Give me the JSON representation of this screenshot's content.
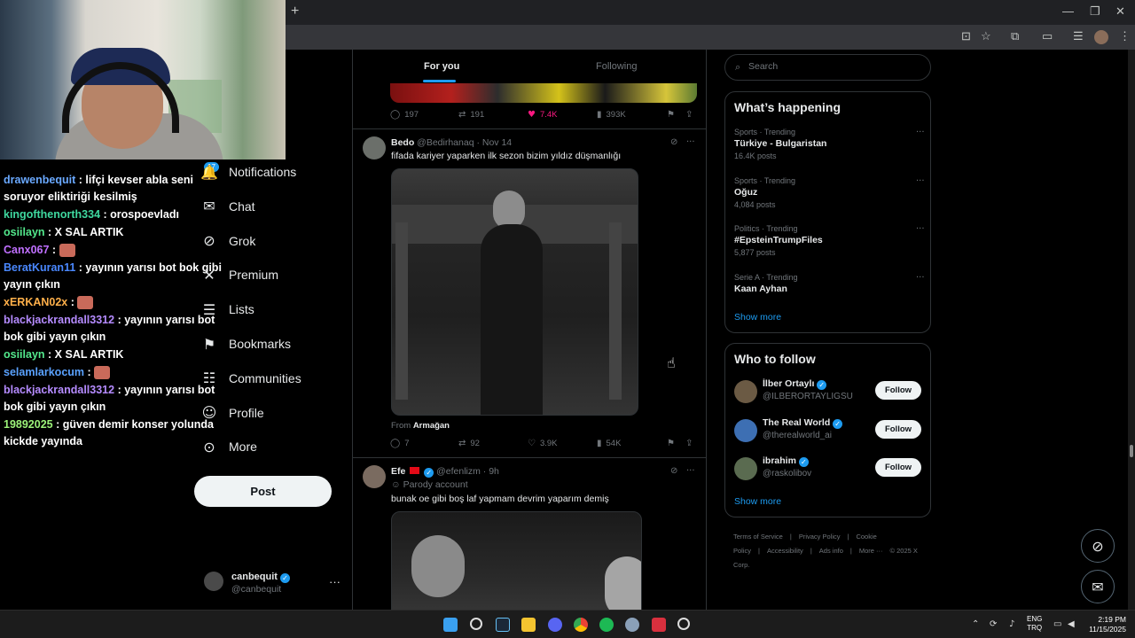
{
  "browser": {
    "new_tab_icon": "plus-icon",
    "window_controls": [
      "minimize-icon",
      "maximize-icon",
      "close-icon"
    ]
  },
  "chat": [
    {
      "user": "drawenbequit",
      "user_color": "#6aa9ff",
      "text": ": lifçi kevser abla seni soruyor eliktiriği kesilmiş"
    },
    {
      "user": "kingofthenorth334",
      "user_color": "#3fd9a0",
      "text": ": orospoevladı"
    },
    {
      "user": "osiilayn",
      "user_color": "#53e88c",
      "text": ": X SAL ARTIK"
    },
    {
      "user": "Canx067",
      "user_color": "#c070ff",
      "text": ":",
      "emote": true
    },
    {
      "user": "BeratKuran11",
      "user_color": "#4a88ff",
      "text": ": yayının yarısı bot bok gibi yayın çıkın"
    },
    {
      "user": "xERKAN02x",
      "user_color": "#ffb04a",
      "text": ":",
      "emote": true
    },
    {
      "user": "blackjackrandall3312",
      "user_color": "#b58bff",
      "text": ": yayının yarısı bot bok gibi yayın çıkın"
    },
    {
      "user": "osiilayn",
      "user_color": "#53e88c",
      "text": ": X SAL ARTIK"
    },
    {
      "user": "selamlarkocum",
      "user_color": "#5aa2ff",
      "text": ":",
      "emote": true
    },
    {
      "user": "blackjackrandall3312",
      "user_color": "#b58bff",
      "text": ": yayının yarısı bot bok gibi yayın çıkın"
    },
    {
      "user": "19892025",
      "user_color": "#9cf279",
      "text": ": güven demir konser yolunda kickde yayında"
    }
  ],
  "nav": {
    "notifications_badge": "17",
    "items": [
      {
        "label": "Notifications",
        "icon": "bell-icon"
      },
      {
        "label": "Chat",
        "icon": "mail-icon"
      },
      {
        "label": "Grok",
        "icon": "grok-icon"
      },
      {
        "label": "Premium",
        "icon": "x-logo-icon"
      },
      {
        "label": "Lists",
        "icon": "list-icon"
      },
      {
        "label": "Bookmarks",
        "icon": "bookmark-icon"
      },
      {
        "label": "Communities",
        "icon": "people-icon"
      },
      {
        "label": "Profile",
        "icon": "person-icon"
      },
      {
        "label": "More",
        "icon": "more-circle-icon"
      }
    ],
    "post_label": "Post",
    "account": {
      "name": "canbequit",
      "handle": "@canbequit"
    }
  },
  "feed": {
    "tabs": {
      "for_you": "For you",
      "following": "Following"
    },
    "top_actions": {
      "replies": "197",
      "reposts": "191",
      "likes": "7.4K",
      "views": "393K"
    },
    "tweet1": {
      "name": "Bedo",
      "handle": "@Bedirhanaq",
      "time": "· Nov 14",
      "text": "fifada kariyer yaparken ilk sezon bizim yıldız düşmanlığı",
      "from_label": "From",
      "from_name": "Armağan",
      "actions": {
        "replies": "7",
        "reposts": "92",
        "likes": "3.9K",
        "views": "54K"
      }
    },
    "tweet2": {
      "name": "Efe",
      "handle": "@efenlizm",
      "time": "· 9h",
      "parody": "Parody account",
      "text": "bunak oe gibi boş laf yapmam devrim yaparım demiş"
    }
  },
  "sidebar": {
    "search_placeholder": "Search",
    "trends_title": "What’s happening",
    "trends": [
      {
        "context": "Sports · Trending",
        "title": "Türkiye - Bulgaristan",
        "posts": "16.4K posts"
      },
      {
        "context": "Sports · Trending",
        "title": "Oğuz",
        "posts": "4,084 posts"
      },
      {
        "context": "Politics · Trending",
        "title": "#EpsteinTrumpFiles",
        "posts": "5,877 posts"
      },
      {
        "context": "Serie A · Trending",
        "title": "Kaan Ayhan",
        "posts": ""
      }
    ],
    "show_more": "Show more",
    "who_title": "Who to follow",
    "follow_label": "Follow",
    "who": [
      {
        "name": "İlber Ortaylı",
        "handle": "@ILBERORTAYLIGSU",
        "avatar_color": "#6b5a44"
      },
      {
        "name": "The Real World",
        "handle": "@therealworld_ai",
        "avatar_color": "#3d6fb3"
      },
      {
        "name": "ibrahim",
        "handle": "@raskolibov",
        "avatar_color": "#5a6b50"
      }
    ],
    "footer": [
      "Terms of Service",
      "|",
      "Privacy Policy",
      "|",
      "Cookie Policy",
      "|",
      "Accessibility",
      "|",
      "Ads info",
      "|",
      "More ···",
      "© 2025 X Corp."
    ]
  },
  "taskbar": {
    "lang_top": "ENG",
    "lang_bottom": "TRQ",
    "time": "2:19 PM",
    "date": "11/15/2025"
  }
}
